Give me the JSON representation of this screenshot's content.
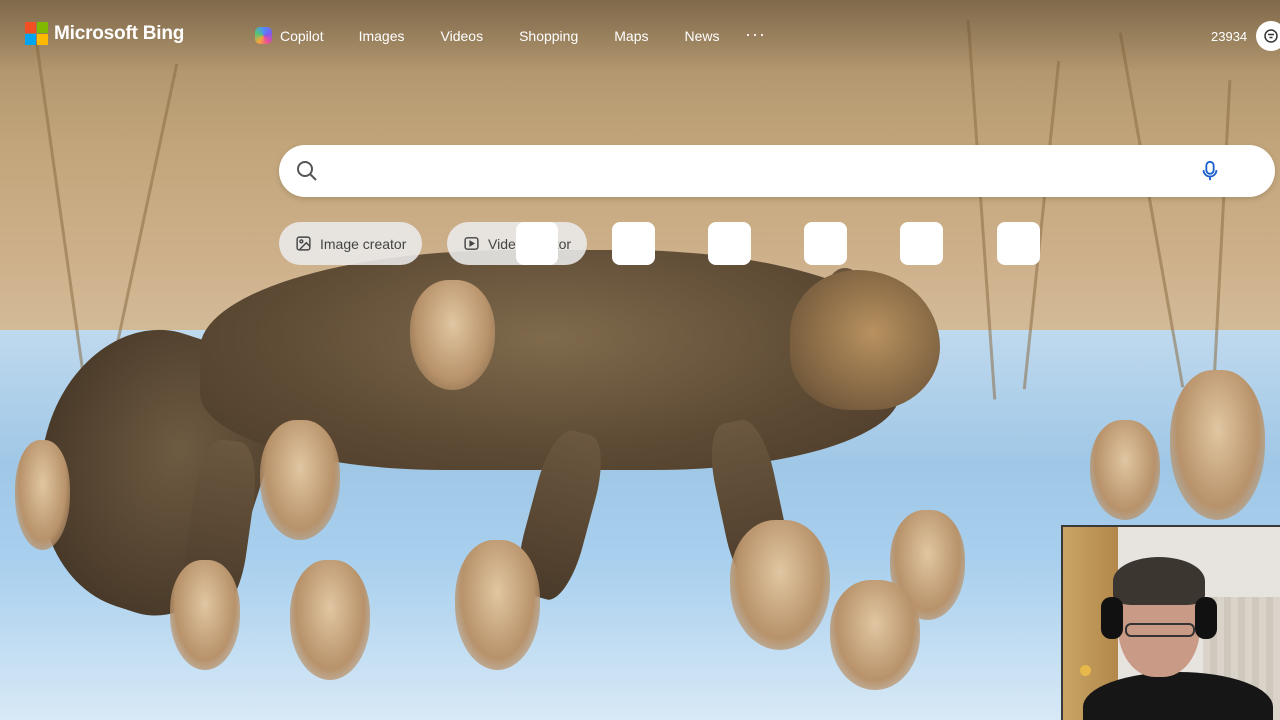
{
  "brand": {
    "name": "Microsoft Bing",
    "logo_colors": [
      "#f25022",
      "#7fba00",
      "#00a4ef",
      "#ffb900"
    ]
  },
  "nav": {
    "items": [
      {
        "label": "Copilot",
        "icon": "copilot-icon"
      },
      {
        "label": "Images"
      },
      {
        "label": "Videos"
      },
      {
        "label": "Shopping"
      },
      {
        "label": "Maps"
      },
      {
        "label": "News"
      }
    ],
    "more": "···"
  },
  "rewards": {
    "points": "23934",
    "icon": "rewards-trophy-icon"
  },
  "search": {
    "value": "",
    "placeholder": "",
    "icons": [
      "search-icon",
      "microphone-icon"
    ]
  },
  "chips": [
    {
      "label": "Image creator",
      "icon": "image-creator-icon"
    },
    {
      "label": "Video creator",
      "icon": "video-creator-icon"
    }
  ],
  "background": {
    "subject": "leopard cat walking through snow and reeds"
  },
  "overlay": {
    "webcam": "webcam-video-overlay"
  }
}
